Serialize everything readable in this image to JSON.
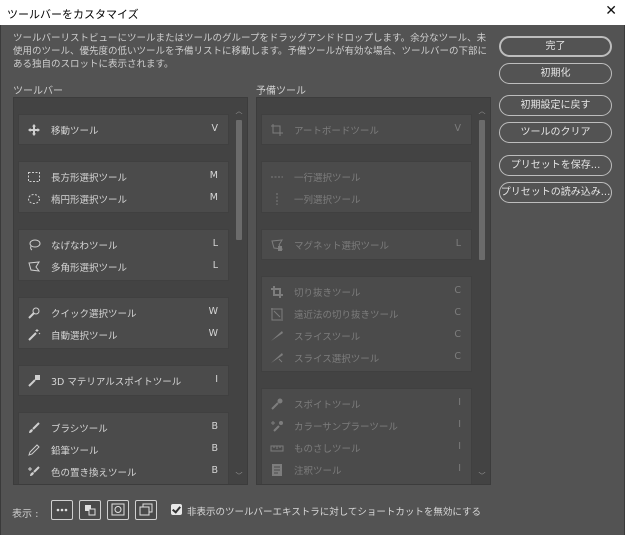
{
  "window": {
    "title": "ツールバーをカスタマイズ",
    "close_glyph": "✕"
  },
  "description": "ツールバーリストビューにツールまたはツールのグループをドラッグアンドドロップします。余分なツール、未使用のツール、優先度の低いツールを予備リストに移動します。予備ツールが有効な場合、ツールバーの下部にある独自のスロットに表示されます。",
  "toolbar_label": "ツールバー",
  "reserve_label": "予備ツール",
  "toolbar_groups": [
    {
      "tools": [
        {
          "icon": "move-icon",
          "label": "移動ツール",
          "key": "V"
        }
      ]
    },
    {
      "tools": [
        {
          "icon": "rect-marquee-icon",
          "label": "長方形選択ツール",
          "key": "M"
        },
        {
          "icon": "ellipse-marquee-icon",
          "label": "楕円形選択ツール",
          "key": "M"
        }
      ]
    },
    {
      "tools": [
        {
          "icon": "lasso-icon",
          "label": "なげなわツール",
          "key": "L"
        },
        {
          "icon": "polygon-lasso-icon",
          "label": "多角形選択ツール",
          "key": "L"
        }
      ]
    },
    {
      "tools": [
        {
          "icon": "quick-select-icon",
          "label": "クイック選択ツール",
          "key": "W"
        },
        {
          "icon": "magic-wand-icon",
          "label": "自動選択ツール",
          "key": "W"
        }
      ]
    },
    {
      "tools": [
        {
          "icon": "3d-eyedropper-icon",
          "label": "3D マテリアルスポイトツール",
          "key": "I"
        }
      ]
    },
    {
      "tools": [
        {
          "icon": "brush-icon",
          "label": "ブラシツール",
          "key": "B"
        },
        {
          "icon": "pencil-icon",
          "label": "鉛筆ツール",
          "key": "B"
        },
        {
          "icon": "color-replace-icon",
          "label": "色の置き換えツール",
          "key": "B"
        }
      ]
    }
  ],
  "reserve_groups": [
    {
      "tools": [
        {
          "icon": "artboard-icon",
          "label": "アートボードツール",
          "key": "V"
        }
      ]
    },
    {
      "tools": [
        {
          "icon": "single-row-icon",
          "label": "一行選択ツール",
          "key": ""
        },
        {
          "icon": "single-column-icon",
          "label": "一列選択ツール",
          "key": ""
        }
      ]
    },
    {
      "tools": [
        {
          "icon": "magnetic-lasso-icon",
          "label": "マグネット選択ツール",
          "key": "L"
        }
      ]
    },
    {
      "tools": [
        {
          "icon": "crop-icon",
          "label": "切り抜きツール",
          "key": "C"
        },
        {
          "icon": "perspective-crop-icon",
          "label": "遠近法の切り抜きツール",
          "key": "C"
        },
        {
          "icon": "slice-icon",
          "label": "スライスツール",
          "key": "C"
        },
        {
          "icon": "slice-select-icon",
          "label": "スライス選択ツール",
          "key": "C"
        }
      ]
    },
    {
      "tools": [
        {
          "icon": "eyedropper-icon",
          "label": "スポイトツール",
          "key": "I"
        },
        {
          "icon": "color-sampler-icon",
          "label": "カラーサンプラーツール",
          "key": "I"
        },
        {
          "icon": "ruler-icon",
          "label": "ものさしツール",
          "key": "I"
        },
        {
          "icon": "note-icon",
          "label": "注釈ツール",
          "key": "I"
        }
      ]
    }
  ],
  "buttons": {
    "done": "完了",
    "reset": "初期化",
    "restore_defaults": "初期設定に戻す",
    "clear_tools": "ツールのクリア",
    "save_preset": "プリセットを保存...",
    "load_preset": "プリセットの読み込み..."
  },
  "footer": {
    "show_label": "表示 :",
    "view_icons": [
      "more-icon",
      "toggle-screen-icon",
      "quick-mask-icon",
      "screen-mode-icon"
    ],
    "checkbox_checked": true,
    "checkbox_label": "非表示のツールバーエキストラに対してショートカットを無効にする"
  }
}
